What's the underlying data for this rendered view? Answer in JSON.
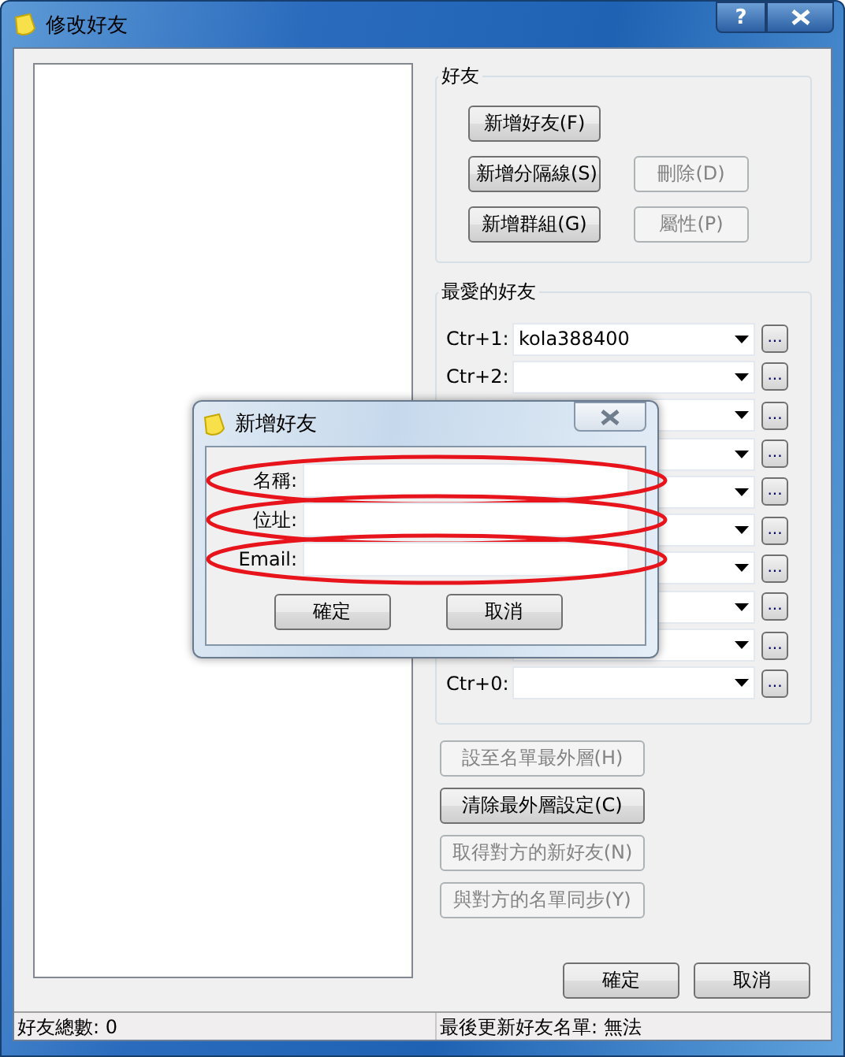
{
  "window": {
    "title": "修改好友",
    "help": "?"
  },
  "friends_group": {
    "title": "好友",
    "buttons": [
      {
        "label": "新增好友(F)",
        "disabled": false
      },
      {
        "label": "新增分隔線(S)",
        "disabled": false
      },
      {
        "label": "刪除(D)",
        "disabled": true
      },
      {
        "label": "新增群組(G)",
        "disabled": false
      },
      {
        "label": "屬性(P)",
        "disabled": true
      }
    ]
  },
  "favorites": {
    "title": "最愛的好友",
    "rows": [
      {
        "label": "Ctr+1:",
        "value": "kola388400",
        "more": "..."
      },
      {
        "label": "Ctr+2:",
        "value": "",
        "more": "..."
      },
      {
        "more": "..."
      },
      {
        "more": "..."
      },
      {
        "more": "..."
      },
      {
        "more": "..."
      },
      {
        "more": "..."
      },
      {
        "more": "..."
      },
      {
        "more": "..."
      },
      {
        "label": "Ctr+0:",
        "value": "",
        "more": "..."
      }
    ]
  },
  "actions": [
    {
      "label": "設至名單最外層(H)",
      "disabled": true
    },
    {
      "label": "清除最外層設定(C)",
      "disabled": false
    },
    {
      "label": "取得對方的新好友(N)",
      "disabled": true
    },
    {
      "label": "與對方的名單同步(Y)",
      "disabled": true
    }
  ],
  "footer_buttons": [
    "確定",
    "取消"
  ],
  "status_bar": [
    "好友總數: 0",
    "最後更新好友名單: 無法"
  ],
  "dialog": {
    "title": "新增好友",
    "fields": [
      {
        "label": "名稱:",
        "highlighted": true
      },
      {
        "label": "位址:",
        "highlighted": true
      },
      {
        "label": "Email:",
        "highlighted": true
      }
    ],
    "buttons": [
      "確定",
      "取消"
    ]
  }
}
